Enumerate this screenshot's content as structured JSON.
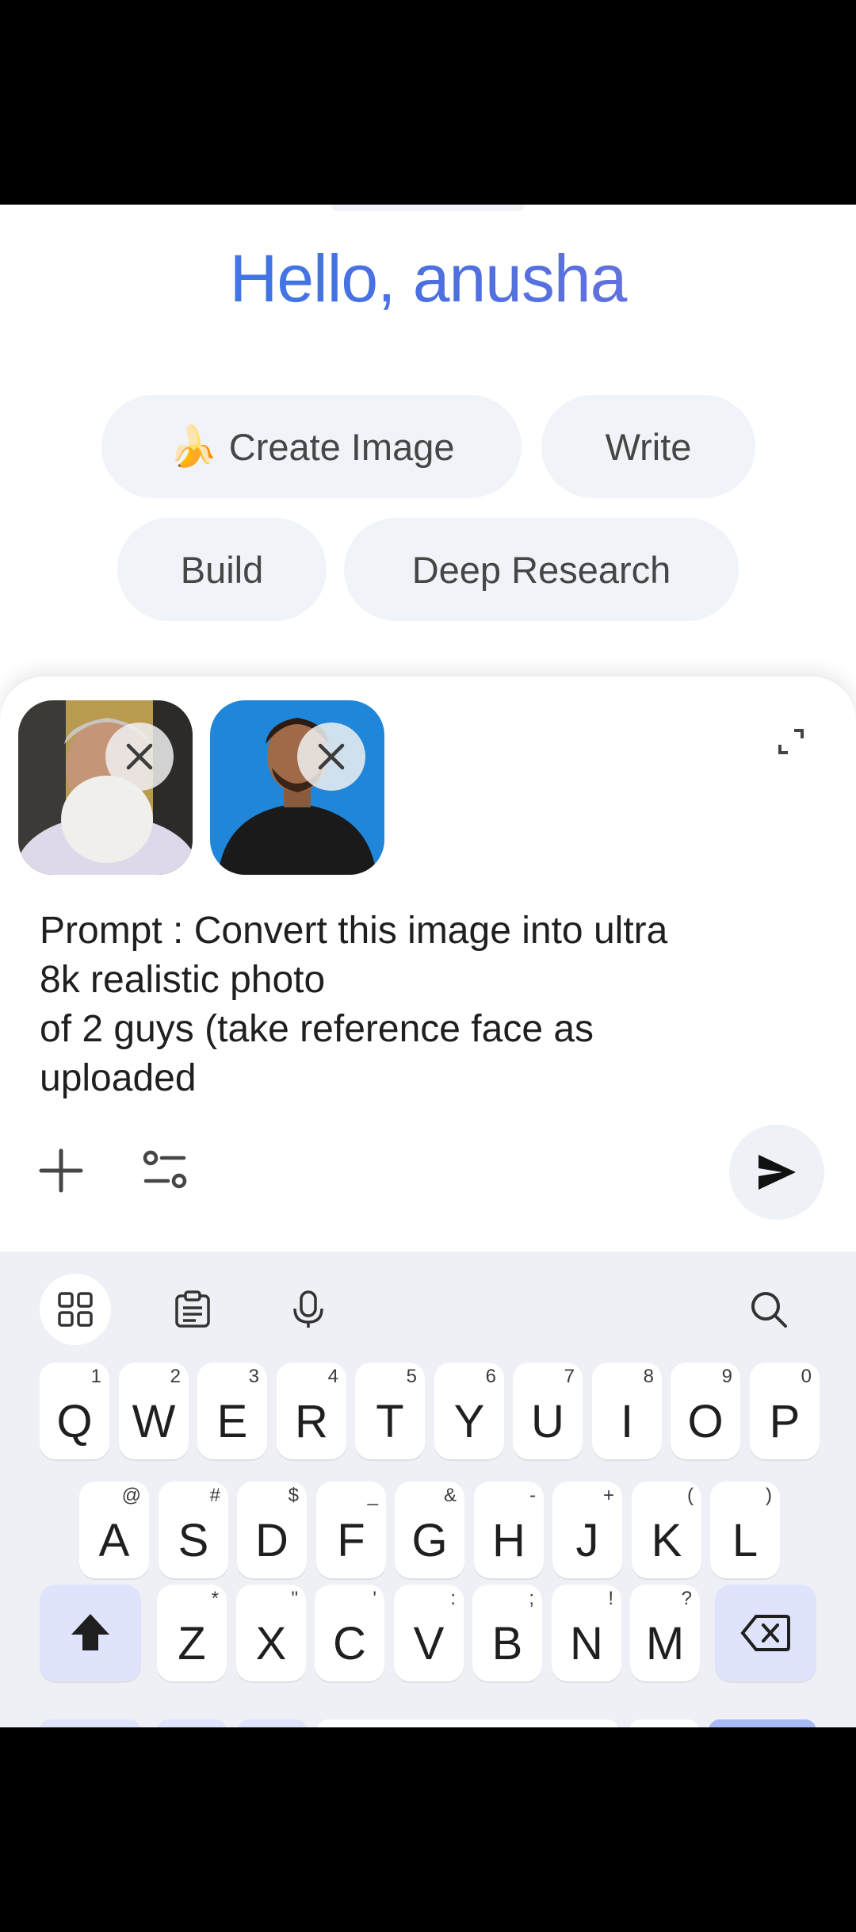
{
  "greeting": "Hello, anusha",
  "chips": [
    {
      "label": "Create Image",
      "emoji": "🍌"
    },
    {
      "label": "Write"
    },
    {
      "label": "Build"
    },
    {
      "label": "Deep Research"
    }
  ],
  "attachments": [
    {
      "name": "attachment-1"
    },
    {
      "name": "attachment-2"
    }
  ],
  "prompt": {
    "text": "Prompt : Convert this image into ultra\n8k realistic photo\nof 2 guys (take reference face as\nuploaded"
  },
  "colors": {
    "accent": "#2f7ce8",
    "chip_bg": "#f0f4f9",
    "keyboard_bg": "#eef0f5",
    "special_key": "#dfe3fb"
  },
  "keyboard": {
    "toolbar": [
      "apps-grid-icon",
      "clipboard-icon",
      "microphone-icon",
      "search-icon"
    ],
    "row1": [
      {
        "k": "Q",
        "h": "1"
      },
      {
        "k": "W",
        "h": "2"
      },
      {
        "k": "E",
        "h": "3"
      },
      {
        "k": "R",
        "h": "4"
      },
      {
        "k": "T",
        "h": "5"
      },
      {
        "k": "Y",
        "h": "6"
      },
      {
        "k": "U",
        "h": "7"
      },
      {
        "k": "I",
        "h": "8"
      },
      {
        "k": "O",
        "h": "9"
      },
      {
        "k": "P",
        "h": "0"
      }
    ],
    "row2": [
      {
        "k": "A",
        "h": "@"
      },
      {
        "k": "S",
        "h": "#"
      },
      {
        "k": "D",
        "h": "$"
      },
      {
        "k": "F",
        "h": "_"
      },
      {
        "k": "G",
        "h": "&"
      },
      {
        "k": "H",
        "h": "-"
      },
      {
        "k": "J",
        "h": "+"
      },
      {
        "k": "K",
        "h": "("
      },
      {
        "k": "L",
        "h": ")"
      }
    ],
    "row3": [
      {
        "k": "Z",
        "h": "*"
      },
      {
        "k": "X",
        "h": "\""
      },
      {
        "k": "C",
        "h": "'"
      },
      {
        "k": "V",
        "h": ":"
      },
      {
        "k": "B",
        "h": ";"
      },
      {
        "k": "N",
        "h": "!"
      },
      {
        "k": "M",
        "h": "?"
      }
    ]
  }
}
